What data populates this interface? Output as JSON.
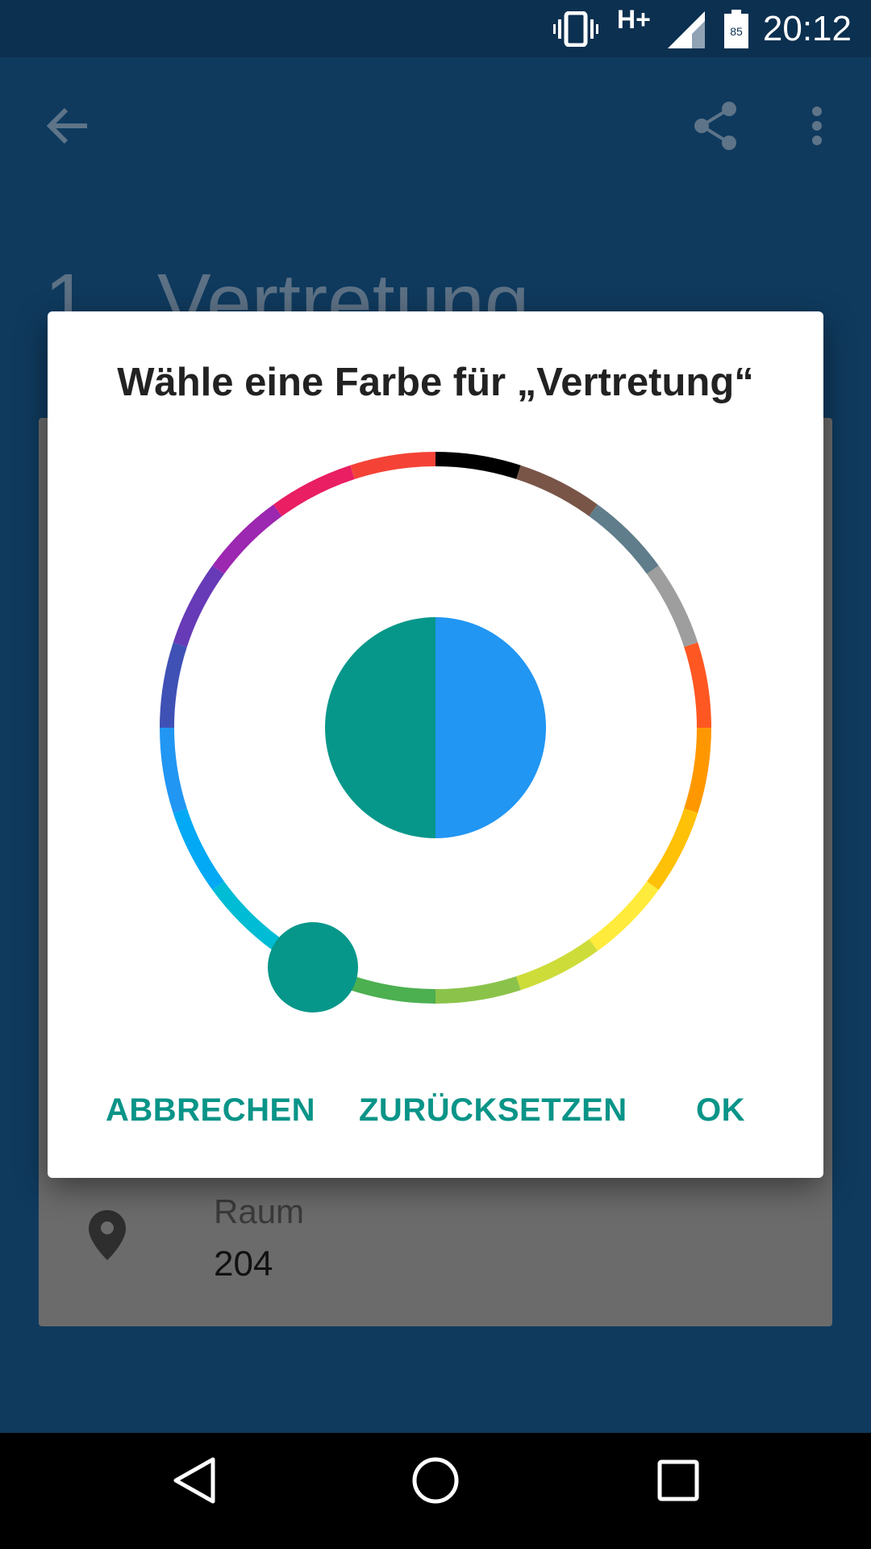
{
  "status_bar": {
    "time": "20:12",
    "network_type": "H+",
    "battery_level": "85",
    "icons": [
      "vibrate-icon",
      "network-type-icon",
      "signal-icon",
      "battery-icon"
    ]
  },
  "app_bar": {
    "icons": [
      "back-arrow-icon",
      "share-icon",
      "more-vert-icon"
    ]
  },
  "background_page": {
    "lesson_number": "1",
    "lesson_title": "Vertretung",
    "room_label": "Raum",
    "room_value": "204"
  },
  "dialog": {
    "title": "Wähle eine Farbe für „Vertretung“",
    "buttons": {
      "cancel": "ABBRECHEN",
      "reset": "ZURÜCKSETZEN",
      "ok": "OK"
    },
    "preview": {
      "old_color": "#06978a",
      "new_color": "#2196f3"
    },
    "selected_color": "#06978a",
    "palette": [
      "#000000",
      "#795548",
      "#607d8b",
      "#9e9e9e",
      "#ff5722",
      "#ff9800",
      "#ffc107",
      "#ffeb3b",
      "#cddc39",
      "#8bc34a",
      "#4caf50",
      "#06978a",
      "#00bcd4",
      "#03a9f4",
      "#2196f3",
      "#3f51b5",
      "#673ab7",
      "#9c27b0",
      "#e91e63",
      "#f44336"
    ]
  },
  "colors": {
    "accent": "#0a9488",
    "app_bar": "#0f3a5e",
    "status_bar": "#0c3050"
  },
  "nav_bar": {
    "icons": [
      "back-triangle-icon",
      "home-circle-icon",
      "recents-square-icon"
    ]
  }
}
